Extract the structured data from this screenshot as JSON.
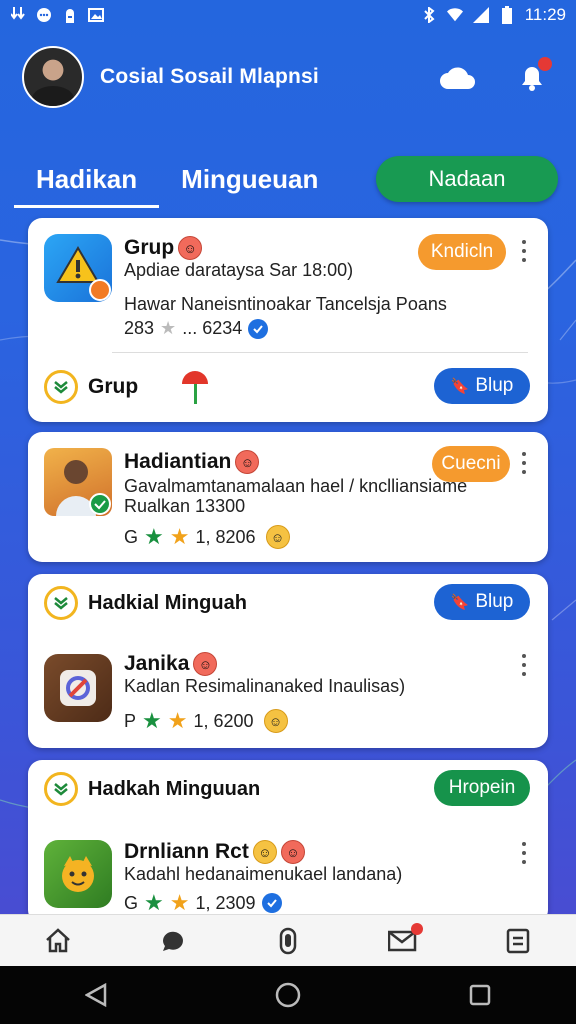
{
  "status_bar": {
    "time": "11:29",
    "icons": [
      "download-icon",
      "chat-icon",
      "bug-icon",
      "image-icon",
      "bluetooth-icon",
      "wifi-icon",
      "signal-icon",
      "battery-icon"
    ]
  },
  "header": {
    "title": "Cosial Sosail Mlapnsi",
    "icons": [
      "cloud-icon",
      "notification-icon"
    ]
  },
  "tabs": [
    {
      "label": "Hadikan",
      "active": true
    },
    {
      "label": "Mingueuan",
      "active": false
    }
  ],
  "tab_action": {
    "label": "Nadaan"
  },
  "cards": [
    {
      "title": "Grup",
      "status": "Kndicln",
      "subtitle": "Apdiae darataysa Sar 18:00)",
      "desc": "Hawar Naneisntinoakar Tancelsja Poans",
      "stats_left": "283",
      "stats_right": "... 6234",
      "footer_label": "Grup",
      "footer_action": "Blup"
    },
    {
      "title": "Hadiantian",
      "status": "Cuecni",
      "subtitle": "Gavalmamtanamalaan hael / knclliansiame",
      "subtitle2": "Rualkan 13300",
      "meta_prefix": "G",
      "meta_value": "1, 8206"
    },
    {
      "header_label": "Hadkial Minguah",
      "header_action": "Blup",
      "title": "Janika",
      "subtitle": "Kadlan Resimalinanaked Inaulisas)",
      "meta_prefix": "P",
      "meta_value": "1, 6200"
    },
    {
      "header_label": "Hadkah Minguuan",
      "header_action": "Hropein",
      "title": "Drnliann Rct",
      "subtitle": "Kadahl hedanaimenukael landana)",
      "meta_prefix": "G",
      "meta_value": "1, 2309"
    }
  ],
  "colors": {
    "primary": "#2466de",
    "accent_green": "#189a52",
    "accent_orange": "#f59a2e",
    "accent_blue": "#1d63d3"
  },
  "bottom_nav": [
    "home-icon",
    "chat-bubble-icon",
    "record-icon",
    "mail-icon",
    "list-icon"
  ],
  "system_nav": [
    "back-icon",
    "home-circle-icon",
    "recents-icon"
  ]
}
